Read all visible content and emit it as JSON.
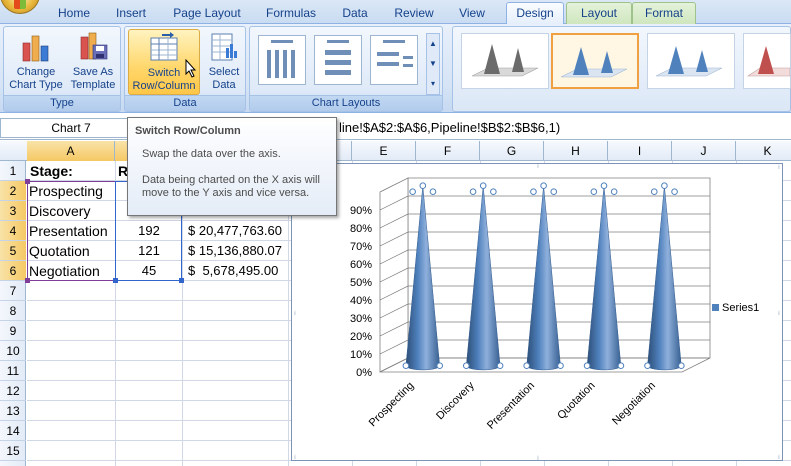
{
  "ribbon": {
    "tabs": [
      "Home",
      "Insert",
      "Page Layout",
      "Formulas",
      "Data",
      "Review",
      "View",
      "Design",
      "Layout",
      "Format"
    ],
    "active_tab": "Design",
    "groups": {
      "type": {
        "label": "Type",
        "change_chart_type": [
          "Change",
          "Chart Type"
        ],
        "save_as_template": [
          "Save As",
          "Template"
        ]
      },
      "data": {
        "label": "Data",
        "switch_row_column": [
          "Switch",
          "Row/Column"
        ],
        "select_data": [
          "Select",
          "Data"
        ]
      },
      "chart_layouts": {
        "label": "Chart Layouts"
      }
    }
  },
  "formula_bar": {
    "name_box": "Chart 7",
    "formula_visible": "line!$A$2:$A$6,Pipeline!$B$2:$B$6,1)"
  },
  "tooltip": {
    "title": "Switch Row/Column",
    "line1": "Swap the data over the axis.",
    "line2": "Data being charted on the X axis will move to the Y axis and vice versa."
  },
  "sheet": {
    "columns": [
      "A",
      "B",
      "C",
      "D",
      "E",
      "F",
      "G",
      "H",
      "I",
      "J",
      "K"
    ],
    "rows": [
      "1",
      "2",
      "3",
      "4",
      "5",
      "6",
      "7",
      "8",
      "9",
      "10",
      "11",
      "12",
      "13",
      "14",
      "15"
    ],
    "a1": "Stage:",
    "b1_partial": "R",
    "cells": [
      {
        "a": "Prospecting",
        "b": "",
        "c": ""
      },
      {
        "a": "Discovery",
        "b": "",
        "c": ""
      },
      {
        "a": "Presentation",
        "b": "192",
        "c": "$ 20,477,763.60"
      },
      {
        "a": "Quotation",
        "b": "121",
        "c": "$ 15,136,880.07"
      },
      {
        "a": "Negotiation",
        "b": "45",
        "c": "$  5,678,495.00"
      }
    ]
  },
  "colors": {
    "cone": "#4f81bd",
    "selection_purple": "#7f3f98",
    "selection_blue": "#3366cc",
    "tooltip_border": "#767676"
  },
  "chart_data": {
    "type": "bar",
    "subtype": "3d-cone",
    "categories": [
      "Prospecting",
      "Discovery",
      "Presentation",
      "Quotation",
      "Negotiation"
    ],
    "series": [
      {
        "name": "Series1",
        "values": [
          1.0,
          1.0,
          1.0,
          1.0,
          1.0
        ]
      }
    ],
    "yticks": [
      "0%",
      "10%",
      "20%",
      "30%",
      "40%",
      "50%",
      "60%",
      "70%",
      "80%",
      "90%"
    ],
    "ylim": [
      0,
      1
    ],
    "legend": "right",
    "grid": true
  }
}
